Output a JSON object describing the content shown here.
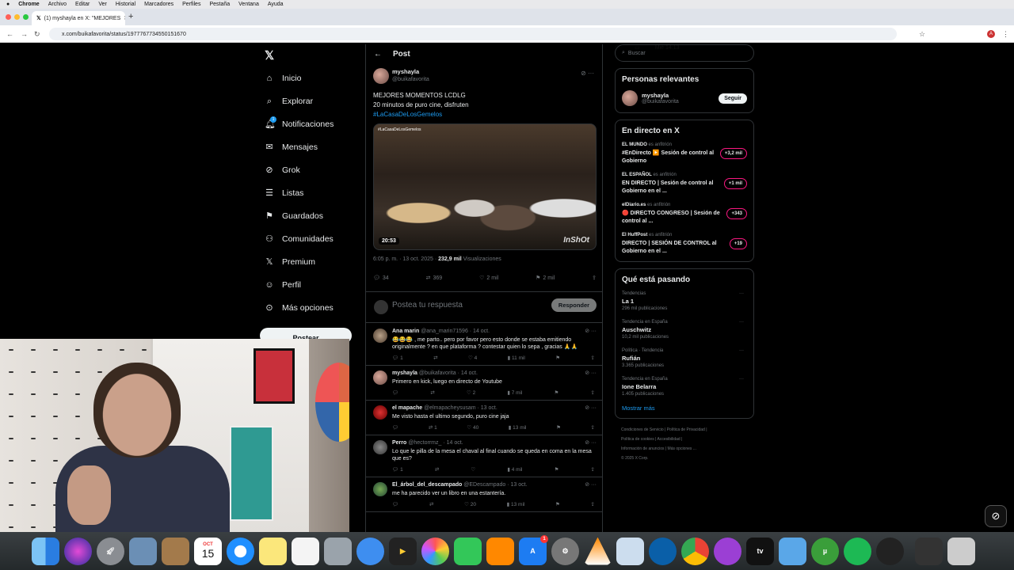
{
  "menubar": {
    "app": "Chrome",
    "items": [
      "Archivo",
      "Editar",
      "Ver",
      "Historial",
      "Marcadores",
      "Perfiles",
      "Pestaña",
      "Ventana",
      "Ayuda"
    ],
    "clock": "Mié 14:13"
  },
  "browser": {
    "tab_title": "(1) myshayla en X: \"MEJORES",
    "url": "x.com/buikafavorita/status/1977767734550151670"
  },
  "nav": {
    "items": [
      "Inicio",
      "Explorar",
      "Notificaciones",
      "Mensajes",
      "Grok",
      "Listas",
      "Guardados",
      "Comunidades",
      "Premium",
      "Perfil",
      "Más opciones"
    ],
    "notif_badge": "1",
    "post_button": "Postear"
  },
  "post": {
    "header": "Post",
    "author_name": "myshayla",
    "author_handle": "@buikafavorita",
    "line1": "MEJORES MOMENTOS LCDLG",
    "line2": "20 minutos de puro cine, disfruten",
    "hashtag": "#LaCasaDeLosGemelos",
    "video_tag": "#LaCasaDeLosGemelos",
    "video_duration": "20:53",
    "video_watermark": "InShOt",
    "time": "6:05 p. m. · 13 oct. 2025 · ",
    "views_count": "232,9 mil",
    "views_label": " Visualizaciones",
    "replies": "34",
    "reposts": "369",
    "likes": "2 mil",
    "bookmarks": "2 mil"
  },
  "reply_box": {
    "placeholder": "Postea tu respuesta",
    "button": "Responder"
  },
  "replies": [
    {
      "name": "Ana marin",
      "handle": "@ana_marin71596 · 14 oct.",
      "text": "😂😂😂 , me parto.. pero por favor pero esto donde se estaba emitiendo originalmente ? en que plataforma ? contestar quien lo sepa , gracias 🙏🙏",
      "r": "1",
      "rt": "",
      "l": "4",
      "v": "11 mil"
    },
    {
      "name": "myshayla",
      "handle": "@buikafavorita · 14 oct.",
      "text": "Primero en kick, luego en directo de Youtube",
      "r": "",
      "rt": "",
      "l": "2",
      "v": "7 mil"
    },
    {
      "name": "el mapache",
      "handle": "@elmapacheysusam · 13 oct.",
      "text": "Me visto hasta el ultimo segundo, puro cine jaja",
      "r": "",
      "rt": "1",
      "l": "40",
      "v": "13 mil"
    },
    {
      "name": "Perro",
      "handle": "@hectorrmz_ · 14 oct.",
      "text": "Lo que le pilla de la mesa el chaval al final cuando se queda en coma en la mesa que es?",
      "r": "1",
      "rt": "",
      "l": "",
      "v": "4 mil"
    },
    {
      "name": "El_árbol_del_descampado",
      "handle": "@EDescampado · 13 oct.",
      "text": "me ha parecido ver un libro en una estantería.",
      "r": "",
      "rt": "",
      "l": "20",
      "v": "13 mil"
    }
  ],
  "sidebar": {
    "search_placeholder": "Buscar",
    "relevant_title": "Personas relevantes",
    "relevant_name": "myshayla",
    "relevant_handle": "@buikafavorita",
    "follow": "Seguir",
    "live_title": "En directo en X",
    "live": [
      {
        "host": "EL MUNDO",
        "role": " es anfitrión",
        "title": "#EnDirecto ▶️ Sesión de control al Gobierno",
        "count": "+3,2 mil"
      },
      {
        "host": "EL ESPAÑOL",
        "role": " es anfitrión",
        "title": "EN DIRECTO | Sesión de control al Gobierno en el ...",
        "count": "+1 mil"
      },
      {
        "host": "elDiario.es",
        "role": " es anfitrión",
        "title": "🔴 DIRECTO CONGRESO | Sesión de control al ...",
        "count": "+343"
      },
      {
        "host": "El HuffPost",
        "role": " es anfitrión",
        "title": "DIRECTO | SESIÓN DE CONTROL al Gobierno en el ...",
        "count": "+19"
      }
    ],
    "trends_title": "Qué está pasando",
    "trends": [
      {
        "ctx": "Tendencias",
        "name": "La 1",
        "posts": "296 mil publicaciones"
      },
      {
        "ctx": "Tendencia en España",
        "name": "Auschwitz",
        "posts": "10,2 mil publicaciones"
      },
      {
        "ctx": "Política · Tendencia",
        "name": "Rufián",
        "posts": "3.365 publicaciones"
      },
      {
        "ctx": "Tendencia en España",
        "name": "Ione Belarra",
        "posts": "1.405 publicaciones"
      }
    ],
    "show_more": "Mostrar más",
    "footer1": "Condiciones de Servicio  |  Política de Privacidad  |",
    "footer2": "Política de cookies  |  Accesibilidad  |",
    "footer3": "Información de anuncios  |  Más opciones ...",
    "footer4": "© 2025 X Corp."
  },
  "dock": {
    "calendar_month": "OCT",
    "calendar_day": "15",
    "appstore_badge": "1"
  }
}
